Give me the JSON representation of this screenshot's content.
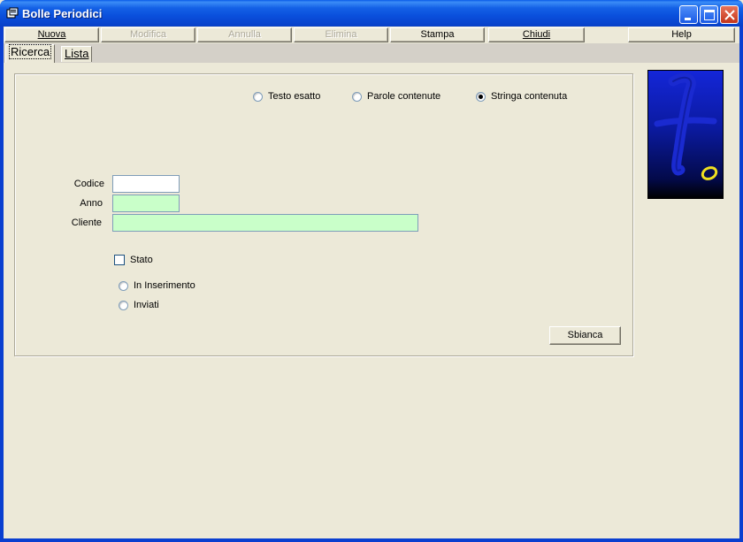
{
  "window": {
    "title": "Bolle Periodici",
    "title_icon": "app-icon",
    "controls": [
      "minimize-icon",
      "maximize-icon",
      "close-icon"
    ]
  },
  "toolbar": {
    "nuova": "Nuova",
    "modifica": "Modifica",
    "annulla": "Annulla",
    "elimina": "Elimina",
    "stampa": "Stampa",
    "chiudi": "Chiudi",
    "help": "Help"
  },
  "tabs": {
    "ricerca": "Ricerca",
    "lista": "Lista"
  },
  "search_mode": {
    "options": [
      "Testo esatto",
      "Parole contenute",
      "Stringa contenuta"
    ],
    "selected": "Stringa contenuta"
  },
  "form": {
    "codice_label": "Codice",
    "codice_value": "",
    "anno_label": "Anno",
    "anno_value": "",
    "cliente_label": "Cliente",
    "cliente_value": "",
    "stato_label": "Stato",
    "stato_checked": false,
    "stato_options": [
      "In Inserimento",
      "Inviati"
    ],
    "sbianca": "Sbianca"
  },
  "colors": {
    "title_bar": "#0a4fdc",
    "field_highlight": "#c9ffc9",
    "logo_blue": "#1426d8",
    "logo_accent": "#f0e020"
  }
}
